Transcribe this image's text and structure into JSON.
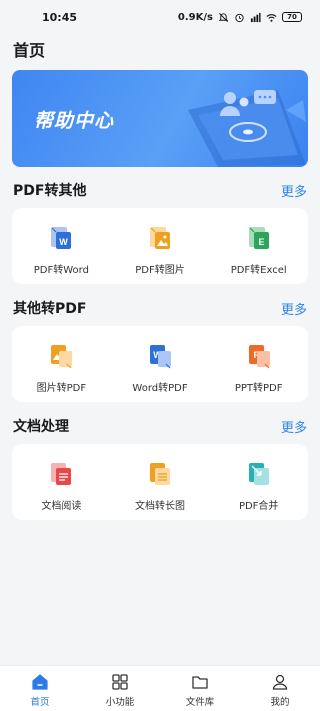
{
  "status": {
    "time": "10:45",
    "speed": "0.9K/s",
    "battery": "70"
  },
  "page": {
    "title": "首页"
  },
  "banner": {
    "text": "帮助中心"
  },
  "sections": [
    {
      "title": "PDF转其他",
      "more": "更多",
      "tools": [
        {
          "label": "PDF转Word",
          "icon": "word-doc-icon"
        },
        {
          "label": "PDF转图片",
          "icon": "image-doc-icon"
        },
        {
          "label": "PDF转Excel",
          "icon": "excel-doc-icon"
        }
      ]
    },
    {
      "title": "其他转PDF",
      "more": "更多",
      "tools": [
        {
          "label": "图片转PDF",
          "icon": "image-doc-icon"
        },
        {
          "label": "Word转PDF",
          "icon": "word-doc-icon"
        },
        {
          "label": "PPT转PDF",
          "icon": "ppt-doc-icon"
        }
      ]
    },
    {
      "title": "文档处理",
      "more": "更多",
      "tools": [
        {
          "label": "文档阅读",
          "icon": "read-doc-icon"
        },
        {
          "label": "文档转长图",
          "icon": "long-image-icon"
        },
        {
          "label": "PDF合并",
          "icon": "merge-pdf-icon"
        }
      ]
    }
  ],
  "nav": [
    {
      "label": "首页",
      "icon": "home-icon"
    },
    {
      "label": "小功能",
      "icon": "grid-icon"
    },
    {
      "label": "文件库",
      "icon": "folder-icon"
    },
    {
      "label": "我的",
      "icon": "person-icon"
    }
  ],
  "colors": {
    "accent": "#2e86e8",
    "word": "#2f6fd8",
    "excel": "#2aa55b",
    "image": "#f0a020",
    "ppt": "#ee6a2a",
    "read": "#e94848",
    "merge": "#27b1b6"
  }
}
